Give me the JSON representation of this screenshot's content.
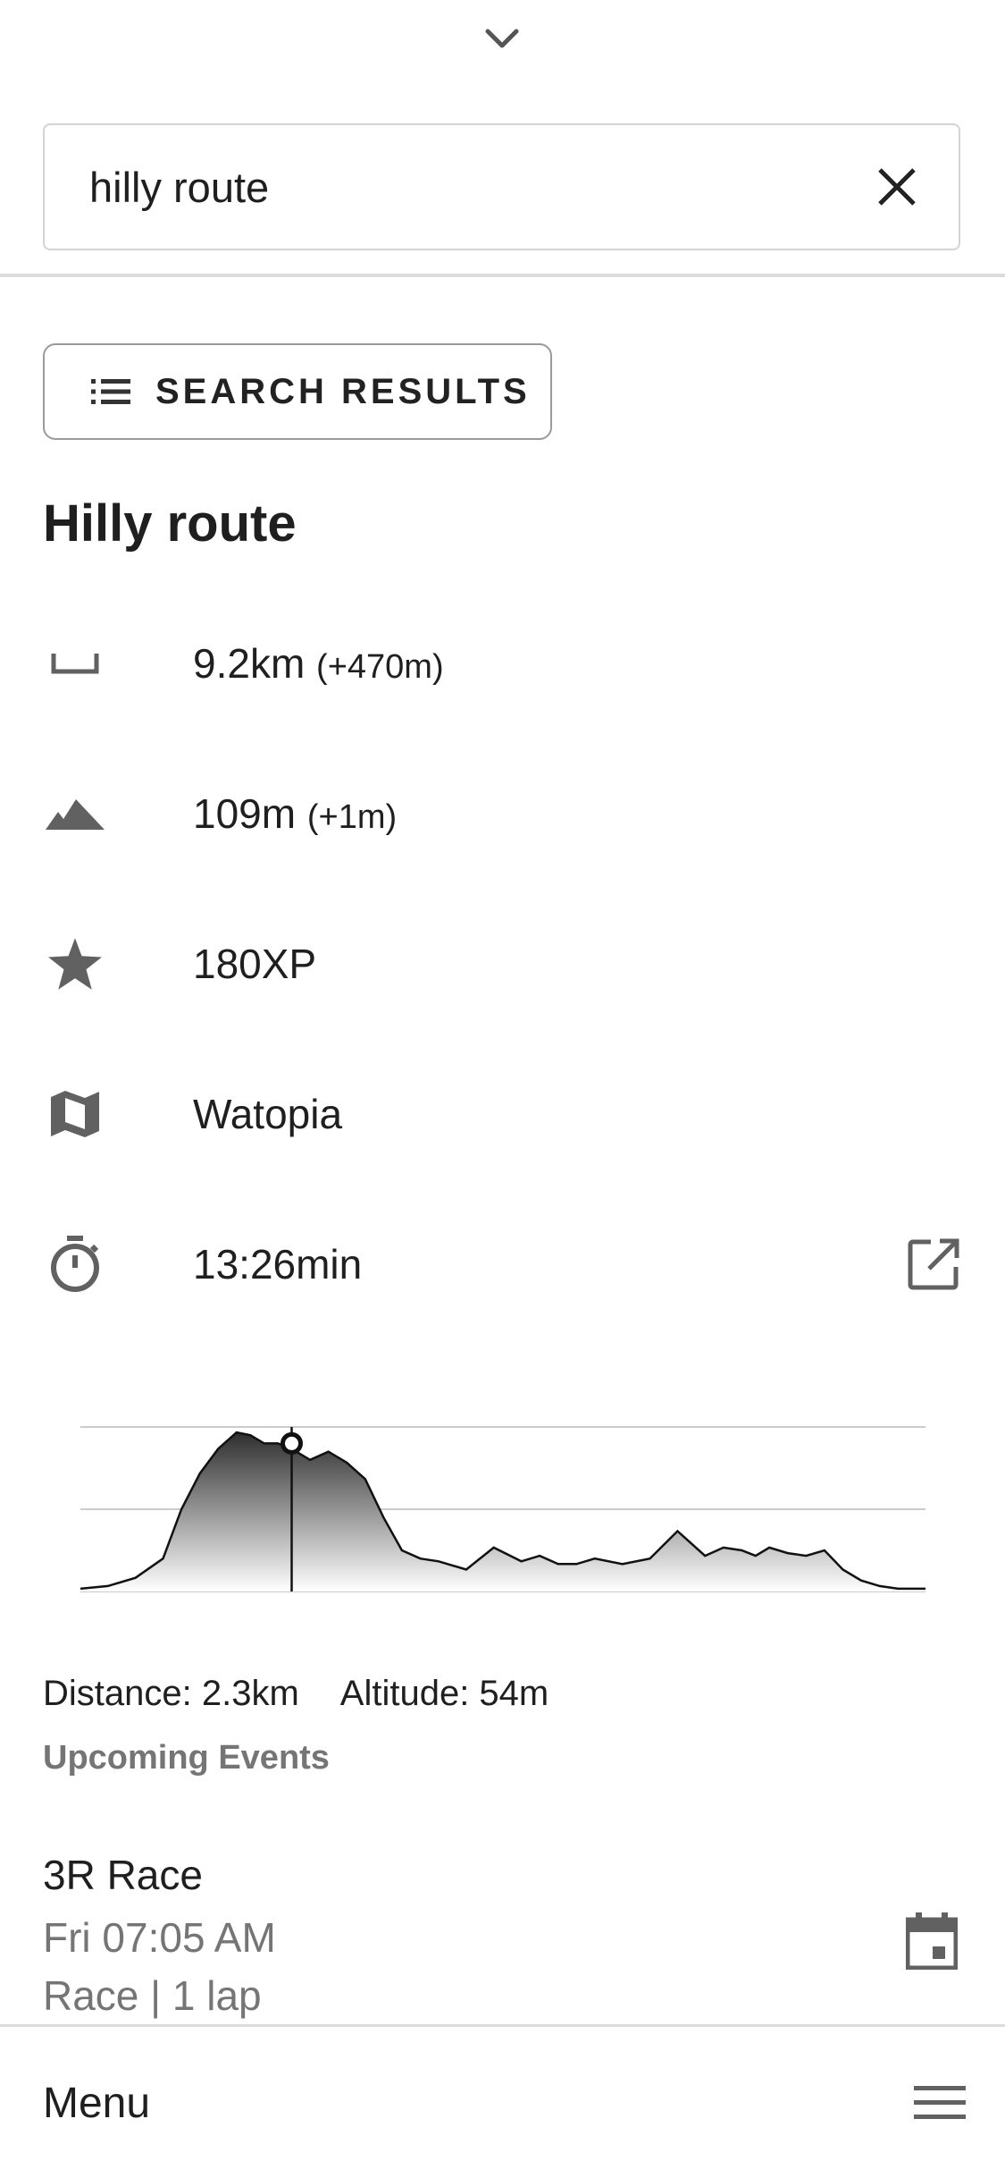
{
  "search": {
    "value": "hilly route"
  },
  "results_button": {
    "label": "SEARCH RESULTS"
  },
  "route": {
    "title": "Hilly route",
    "distance": {
      "value": "9.2km",
      "extra": "(+470m)"
    },
    "elevation": {
      "value": "109m",
      "extra": "(+1m)"
    },
    "xp": "180XP",
    "world": "Watopia",
    "time": "13:26min"
  },
  "chart_data": {
    "type": "area",
    "title": "",
    "xlabel": "",
    "ylabel": "",
    "x_unit": "km",
    "y_unit": "m",
    "xlim": [
      0,
      9.2
    ],
    "ylim": [
      0,
      60
    ],
    "grid": true,
    "series": [
      {
        "x": [
          0,
          0.3,
          0.6,
          0.9,
          1.1,
          1.3,
          1.5,
          1.7,
          1.85,
          2.0,
          2.15,
          2.3,
          2.5,
          2.7,
          2.9,
          3.1,
          3.3,
          3.5,
          3.7,
          3.9,
          4.2,
          4.5,
          4.8,
          5.0,
          5.2,
          5.4,
          5.6,
          5.9,
          6.2,
          6.5,
          6.8,
          7.0,
          7.2,
          7.35,
          7.5,
          7.7,
          7.9,
          8.1,
          8.3,
          8.5,
          8.7,
          8.9,
          9.2
        ],
        "y": [
          1,
          2,
          5,
          12,
          30,
          43,
          52,
          58,
          57,
          54,
          54,
          52,
          48,
          51,
          47,
          41,
          27,
          15,
          12,
          11,
          8,
          16,
          11,
          13,
          10,
          10,
          12,
          10,
          12,
          22,
          13,
          16,
          15,
          13,
          16,
          14,
          13,
          15,
          8,
          4,
          2,
          1,
          1
        ]
      }
    ],
    "marker": {
      "x": 2.3,
      "y": 54
    }
  },
  "readout": {
    "distance": "Distance: 2.3km",
    "altitude": "Altitude: 54m"
  },
  "events": {
    "header": "Upcoming Events",
    "items": [
      {
        "name": "3R Race",
        "time": "Fri 07:05 AM",
        "type": "Race | 1 lap"
      }
    ]
  },
  "bottom": {
    "menu_label": "Menu"
  },
  "colors": {
    "icon": "#616161",
    "muted_text": "#757575",
    "chart_fill_top": "#2e2e2e",
    "grid": "#cccccc"
  }
}
